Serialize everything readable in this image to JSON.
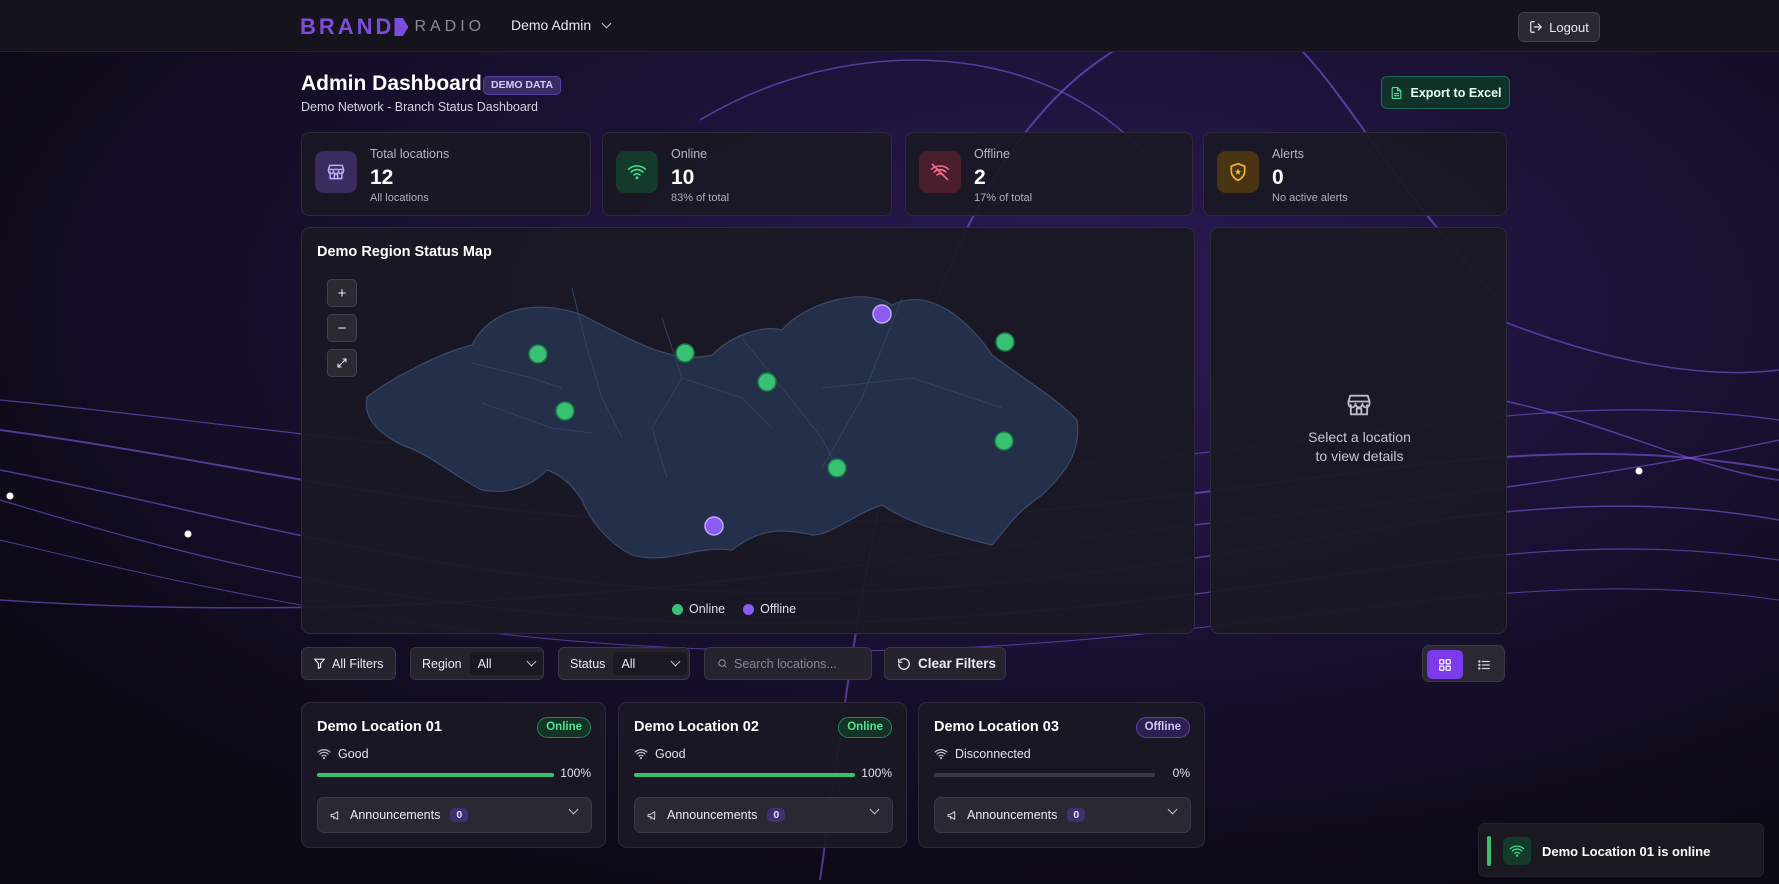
{
  "brand": {
    "part1": "BRAND",
    "part2": "RADIO"
  },
  "user_menu": {
    "label": "Demo Admin"
  },
  "logout_label": "Logout",
  "header": {
    "title": "Admin Dashboard",
    "badge": "DEMO DATA",
    "subtitle": "Demo Network - Branch Status Dashboard",
    "export_label": "Export to Excel"
  },
  "stats": [
    {
      "label": "Total locations",
      "value": "12",
      "sub": "All locations",
      "icon": "store-icon",
      "color": "#a78bfa"
    },
    {
      "label": "Online",
      "value": "10",
      "sub": "83% of total",
      "icon": "wifi-icon",
      "color": "#3ddc84"
    },
    {
      "label": "Offline",
      "value": "2",
      "sub": "17% of total",
      "icon": "wifi-off-icon",
      "color": "#f16a8a"
    },
    {
      "label": "Alerts",
      "value": "0",
      "sub": "No active alerts",
      "icon": "shield-alert-icon",
      "color": "#f5b431"
    }
  ],
  "map": {
    "title": "Demo Region Status Map",
    "legend": {
      "online": "Online",
      "offline": "Offline"
    },
    "colors": {
      "online": "#39c173",
      "offline": "#8a5cf0"
    }
  },
  "detail_panel": {
    "line1": "Select a location",
    "line2": "to view details",
    "icon": "store-icon"
  },
  "filters": {
    "all_filters": "All Filters",
    "region_label": "Region",
    "region_value": "All",
    "status_label": "Status",
    "status_value": "All",
    "search_placeholder": "Search locations...",
    "clear_label": "Clear Filters"
  },
  "locations": [
    {
      "name": "Demo Location 01",
      "status": "Online",
      "signal": "Good",
      "percent": "100%",
      "progress": 1.0,
      "announcements": "Announcements",
      "count": "0"
    },
    {
      "name": "Demo Location 02",
      "status": "Online",
      "signal": "Good",
      "percent": "100%",
      "progress": 1.0,
      "announcements": "Announcements",
      "count": "0"
    },
    {
      "name": "Demo Location 03",
      "status": "Offline",
      "signal": "Disconnected",
      "percent": "0%",
      "progress": 0.0,
      "announcements": "Announcements",
      "count": "0"
    }
  ],
  "toast": {
    "message": "Demo Location 01 is online",
    "icon": "wifi-icon"
  }
}
